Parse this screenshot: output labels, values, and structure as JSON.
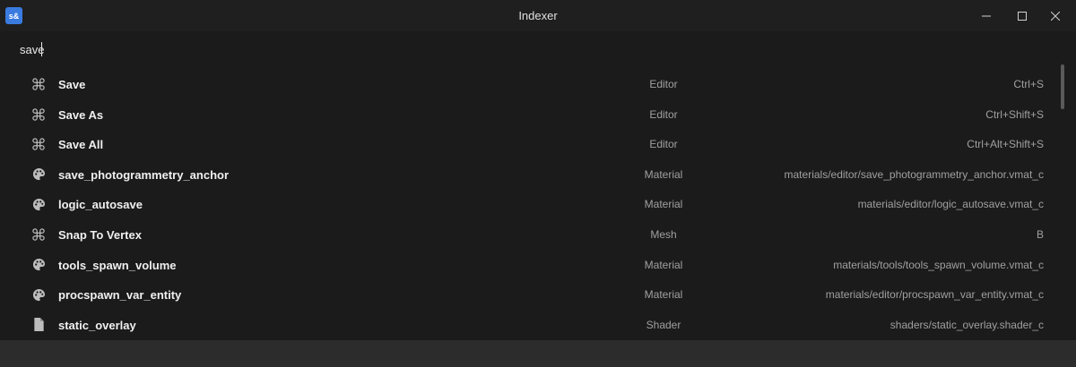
{
  "window": {
    "app_icon_text": "s&",
    "title": "Indexer"
  },
  "search": {
    "value": "save"
  },
  "results": [
    {
      "icon": "command-icon",
      "name": "Save",
      "category": "Editor",
      "detail": "Ctrl+S"
    },
    {
      "icon": "command-icon",
      "name": "Save As",
      "category": "Editor",
      "detail": "Ctrl+Shift+S"
    },
    {
      "icon": "command-icon",
      "name": "Save All",
      "category": "Editor",
      "detail": "Ctrl+Alt+Shift+S"
    },
    {
      "icon": "palette-icon",
      "name": "save_photogrammetry_anchor",
      "category": "Material",
      "detail": "materials/editor/save_photogrammetry_anchor.vmat_c"
    },
    {
      "icon": "palette-icon",
      "name": "logic_autosave",
      "category": "Material",
      "detail": "materials/editor/logic_autosave.vmat_c"
    },
    {
      "icon": "command-icon",
      "name": "Snap To Vertex",
      "category": "Mesh",
      "detail": "B"
    },
    {
      "icon": "palette-icon",
      "name": "tools_spawn_volume",
      "category": "Material",
      "detail": "materials/tools/tools_spawn_volume.vmat_c"
    },
    {
      "icon": "palette-icon",
      "name": "procspawn_var_entity",
      "category": "Material",
      "detail": "materials/editor/procspawn_var_entity.vmat_c"
    },
    {
      "icon": "file-icon",
      "name": "static_overlay",
      "category": "Shader",
      "detail": "shaders/static_overlay.shader_c"
    }
  ],
  "colors": {
    "background": "#1b1b1b",
    "accent": "#3a7be0",
    "muted_text": "#a0a0a0",
    "statusbar": "#2c2c2c"
  }
}
